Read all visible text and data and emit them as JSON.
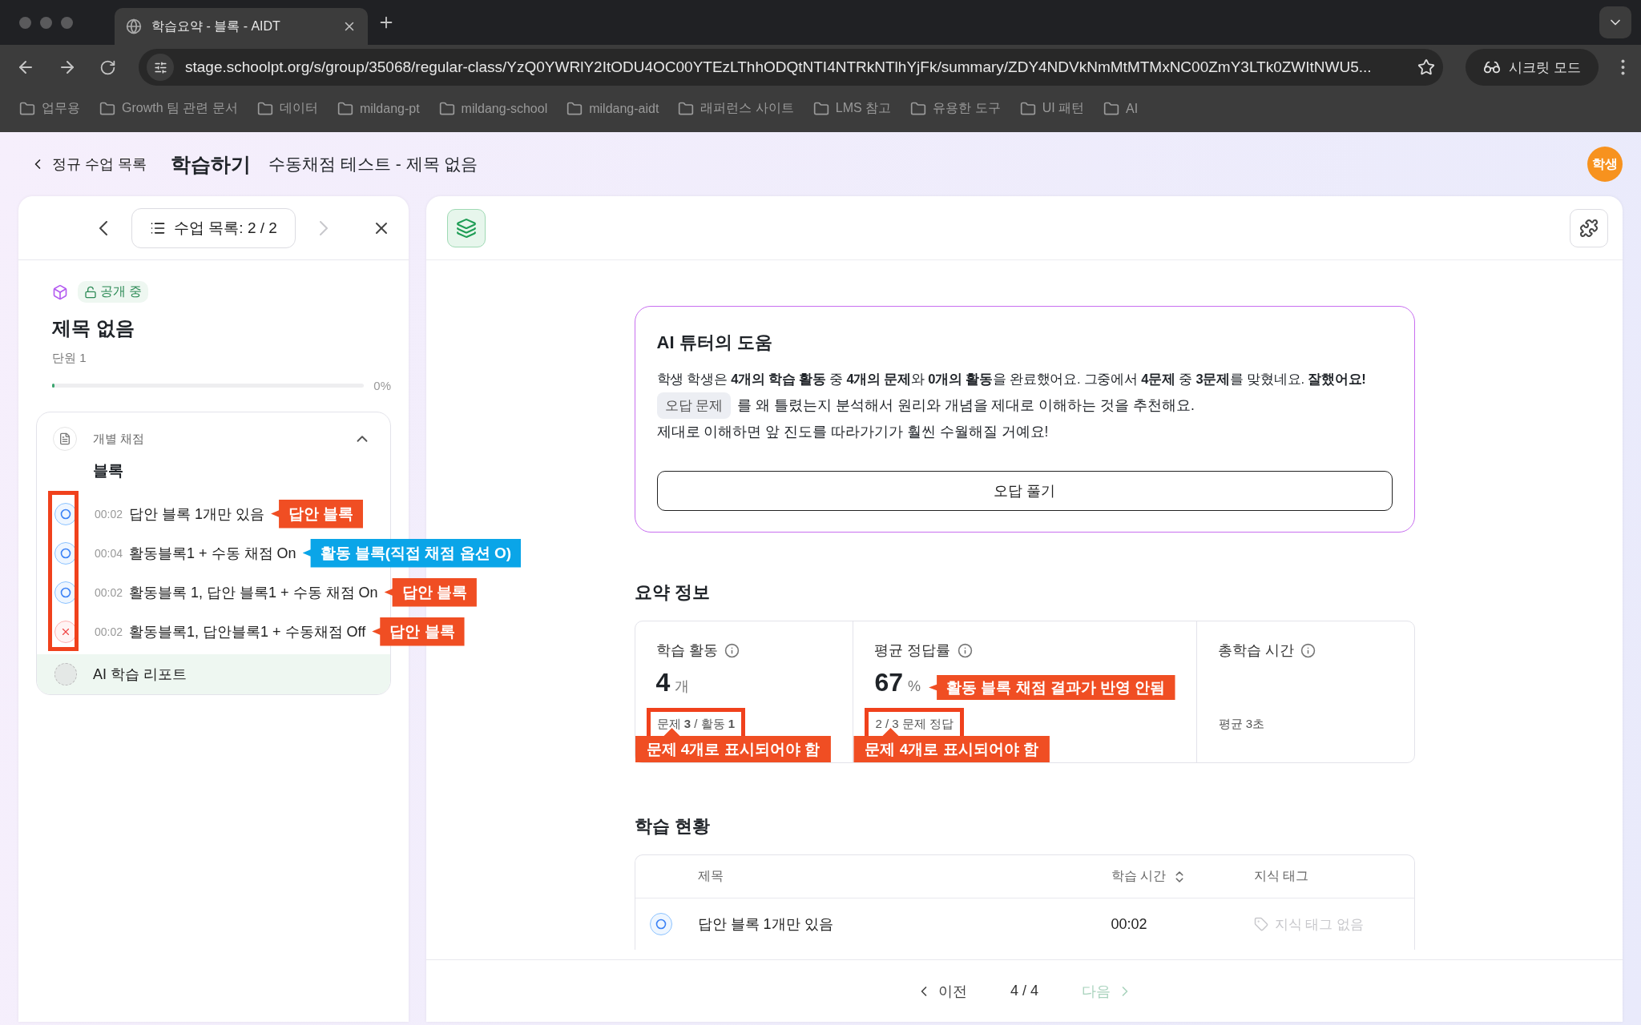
{
  "browser": {
    "tab_title": "학습요약 - 블록 - AIDT",
    "url": "stage.schoolpt.org/s/group/35068/regular-class/YzQ0YWRlY2ItODU4OC00YTEzLThhODQtNTI4NTRkNTlhYjFk/summary/ZDY4NDVkNmMtMTMxNC00ZmY3LTk0ZWItNWU5...",
    "incognito_label": "시크릿 모드",
    "bookmarks": [
      "업무용",
      "Growth 팀 관련 문서",
      "데이터",
      "mildang-pt",
      "mildang-school",
      "mildang-aidt",
      "래퍼런스 사이트",
      "LMS 참고",
      "유용한 도구",
      "UI 패턴",
      "AI"
    ]
  },
  "header": {
    "back_label": "정규 수업 목록",
    "title": "학습하기",
    "subtitle": "수동채점 테스트 - 제목 없음",
    "avatar": "학생"
  },
  "sidebar": {
    "nav_label": "수업 목록: 2 / 2",
    "next_disabled": true,
    "badge": "공개 중",
    "title": "제목 없음",
    "unit": "단원 1",
    "progress": {
      "level": 0,
      "reading": "0%"
    },
    "section": {
      "kind_label": "개별 채점",
      "title": "블록",
      "expanded": true,
      "icons_highlighted": true,
      "items": [
        {
          "time": "00:02",
          "title": "답안 블록 1개만 있음",
          "correct": true,
          "note": {
            "text": "답안 블록",
            "color": "#f04e23"
          }
        },
        {
          "time": "00:04",
          "title": "활동블록1 + 수동 채점 On",
          "correct": true,
          "note": {
            "text": "활동 블록(직접 채점 옵션 O)",
            "color": "#0aa5e8"
          }
        },
        {
          "time": "00:02",
          "title": "활동블록 1, 답안 블록1 + 수동 채점 On",
          "correct": true,
          "note": {
            "text": "답안 블록",
            "color": "#f04e23"
          }
        },
        {
          "time": "00:02",
          "title": "활동블록1, 답안블록1 + 수동채점 Off",
          "correct": false,
          "note": {
            "text": "답안 블록",
            "color": "#f04e23"
          }
        }
      ]
    },
    "report": "AI 학습 리포트"
  },
  "tutor": {
    "title": "AI 튜터의 도움",
    "message": "학생 학생은 **4개의 학습 활동** 중 **4개의 문제**와 **0개의 활동**을 완료했어요. 그중에서 **4문제** 중 **3문제**를 맞혔네요. **잘했어요!**",
    "chip": "오답 문제",
    "advice": "를 왜 틀렸는지 분석해서 원리와 개념을 제대로 이해하는 것을 추천해요.",
    "closing": "제대로 이해하면 앞 진도를 따라가기가 훨씬 수월해질 거예요!",
    "button": "오답 풀기"
  },
  "summary": {
    "title": "요약 정보",
    "stats": [
      {
        "label": "학습 활동",
        "value": "4",
        "unit": "개",
        "detail": "문제 **3** / 활동 **1**",
        "detail_highlighted": true,
        "detail_note": {
          "text": "문제 4개로 표시되어야 함",
          "color": "#f04e23"
        }
      },
      {
        "label": "평균 정답률",
        "value": "67",
        "unit": "%",
        "value_note": {
          "text": "활동 블록 채점 결과가 반영 안됨",
          "color": "#f04e23"
        },
        "detail": "2 / 3 문제 정답",
        "detail_highlighted": true,
        "detail_note": {
          "text": "문제 4개로 표시되어야 함",
          "color": "#f04e23"
        }
      },
      {
        "label": "총학습 시간",
        "detail": "평균 3초",
        "detail_highlighted": false
      }
    ]
  },
  "status": {
    "title": "학습 현황",
    "columns": [
      "제목",
      "학습 시간",
      "지식 태그"
    ],
    "rows": [
      {
        "correct": true,
        "title": "답안 블록 1개만 있음",
        "time": "00:02",
        "tags": "지식 태그 없음"
      }
    ]
  },
  "pager": {
    "prev": "이전",
    "page": "4 / 4",
    "next": "다음",
    "next_disabled": true
  }
}
